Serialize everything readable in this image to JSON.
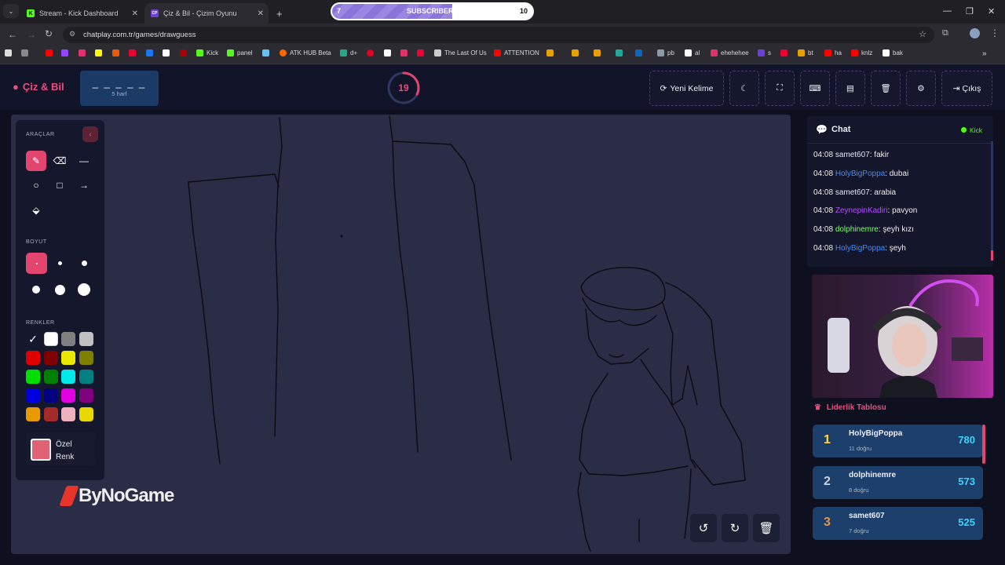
{
  "browser": {
    "tabs": [
      {
        "title": "Stream - Kick Dashboard"
      },
      {
        "title": "Çiz & Bil - Çizim Oyunu"
      }
    ],
    "new_tab": "+",
    "sub_goal": {
      "current": "7",
      "label": "SUBSCRIBERS",
      "target": "10",
      "progress": 0.6
    },
    "url": "chatplay.com.tr/games/drawguess",
    "bookmarks": [
      "Kick",
      "panel",
      "ATK HUB Beta",
      "d+",
      "The Last Of Us",
      "ATTENTION",
      "pb",
      "al",
      "ehehehee",
      "s",
      "bt",
      "ha",
      "knlz",
      "bak"
    ]
  },
  "header": {
    "app_name": "Çiz & Bil",
    "word_mask": "_ _ _ _ _",
    "word_hint": "5 harf",
    "timer": "19",
    "timer_fraction": 0.32,
    "new_word_label": "Yeni Kelime",
    "logout_label": "Çıkış"
  },
  "tools": {
    "tools_heading": "ARAÇLAR",
    "size_heading": "BOYUT",
    "colors_heading": "RENKLER",
    "custom_color_label": "Özel Renk",
    "custom_color": "#e06275",
    "palette": [
      "#111111",
      "#ffffff",
      "#808080",
      "#c0c0c0",
      "#e00000",
      "#800000",
      "#e8e800",
      "#808000",
      "#00e000",
      "#008000",
      "#00e8e8",
      "#008080",
      "#0000e0",
      "#000080",
      "#e000e0",
      "#800080",
      "#e89b00",
      "#a52a2a",
      "#f0b0c0",
      "#e8d800"
    ]
  },
  "brand": "ByNoGame",
  "chat": {
    "title": "Chat",
    "platform": "Kick",
    "messages": [
      {
        "time": "04:08",
        "user": "samet607",
        "color": "#e6e6f0",
        "text": "fakir"
      },
      {
        "time": "04:08",
        "user": "HolyBigPoppa",
        "color": "#3f8cff",
        "text": "dubai"
      },
      {
        "time": "04:08",
        "user": "samet607",
        "color": "#e6e6f0",
        "text": "arabia"
      },
      {
        "time": "04:08",
        "user": "ZeynepinKadiri",
        "color": "#b44cff",
        "text": "pavyon"
      },
      {
        "time": "04:08",
        "user": "dolphinemre",
        "color": "#7dff6b",
        "text": "şeyh kızı"
      },
      {
        "time": "04:08",
        "user": "HolyBigPoppa",
        "color": "#3f8cff",
        "text": "şeyh"
      }
    ]
  },
  "leaderboard": {
    "title": "Liderlik Tablosu",
    "rows": [
      {
        "rank": "1",
        "name": "HolyBigPoppa",
        "correct": "11 doğru",
        "score": "780",
        "rank_color": "#ffd84a"
      },
      {
        "rank": "2",
        "name": "dolphinemre",
        "correct": "8 doğru",
        "score": "573",
        "rank_color": "#c8d0dc"
      },
      {
        "rank": "3",
        "name": "samet607",
        "correct": "7 doğru",
        "score": "525",
        "rank_color": "#e2924a"
      }
    ]
  }
}
